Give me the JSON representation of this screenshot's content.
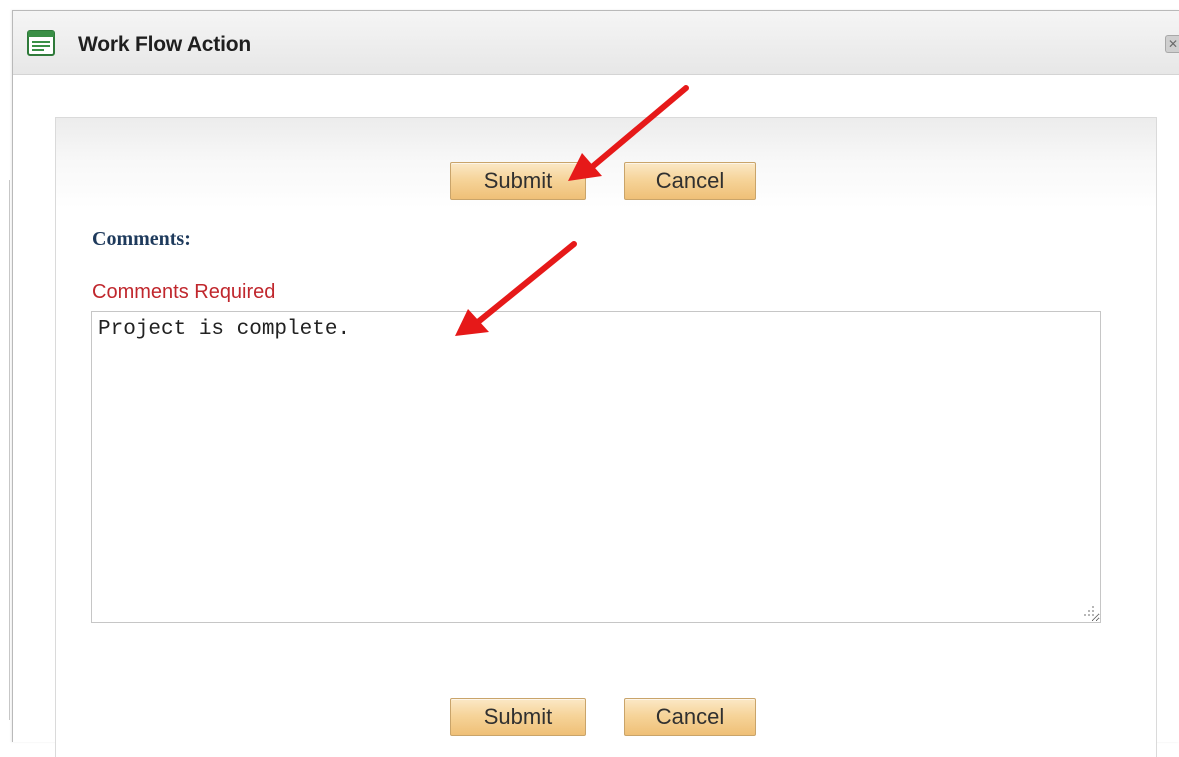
{
  "dialog": {
    "title": "Work Flow Action",
    "close_glyph": "✕",
    "icon": "form-window-icon"
  },
  "actions_top": {
    "submit_label": "Submit",
    "cancel_label": "Cancel"
  },
  "comments": {
    "label": "Comments:",
    "required_text": "Comments Required",
    "value": "Project is complete."
  },
  "actions_bottom": {
    "submit_label": "Submit",
    "cancel_label": "Cancel"
  },
  "annotations": {
    "arrow_color": "#e61919",
    "arrows": [
      "arrow-to-submit-button",
      "arrow-to-comments-field"
    ]
  },
  "colors": {
    "button_gradient_top": "#fbe8c6",
    "button_gradient_bottom": "#efc077",
    "label_color": "#1e3a5c",
    "required_color": "#c0272d"
  }
}
